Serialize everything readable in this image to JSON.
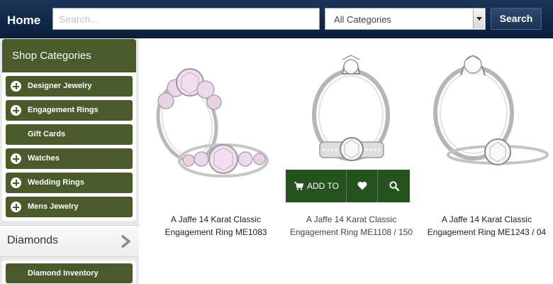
{
  "header": {
    "home_label": "Home",
    "search_placeholder": "Search...",
    "category_select": "All Categories",
    "search_button": "Search"
  },
  "sidebar": {
    "shop_title": "Shop Categories",
    "categories": [
      {
        "label": "Designer Jewelry",
        "expandable": true
      },
      {
        "label": "Engagement Rings",
        "expandable": true
      },
      {
        "label": "Gift Cards",
        "expandable": false
      },
      {
        "label": "Watches",
        "expandable": true
      },
      {
        "label": "Wedding Rings",
        "expandable": true
      },
      {
        "label": "Mens Jewelry",
        "expandable": true
      }
    ],
    "diamonds_title": "Diamonds",
    "diamond_inventory": "Diamond Inventory"
  },
  "products": [
    {
      "name_line1": "A Jaffe 14 Karat Classic",
      "name_line2": "Engagement Ring ME1083"
    },
    {
      "name_line1": "A Jaffe 14 Karat Classic",
      "name_line2": "Engagement Ring ME1108 / 150"
    },
    {
      "name_line1": "A Jaffe 14 Karat Classic",
      "name_line2": "Engagement Ring ME1243 / 04"
    }
  ],
  "product_actions": {
    "add_to_label": "ADD TO",
    "cart_icon": "cart-icon",
    "wishlist_icon": "heart-icon",
    "quickview_icon": "search-icon"
  },
  "colors": {
    "header_bg": "#11284a",
    "sidebar_green": "#4a5a2b",
    "action_green": "#26521f"
  }
}
